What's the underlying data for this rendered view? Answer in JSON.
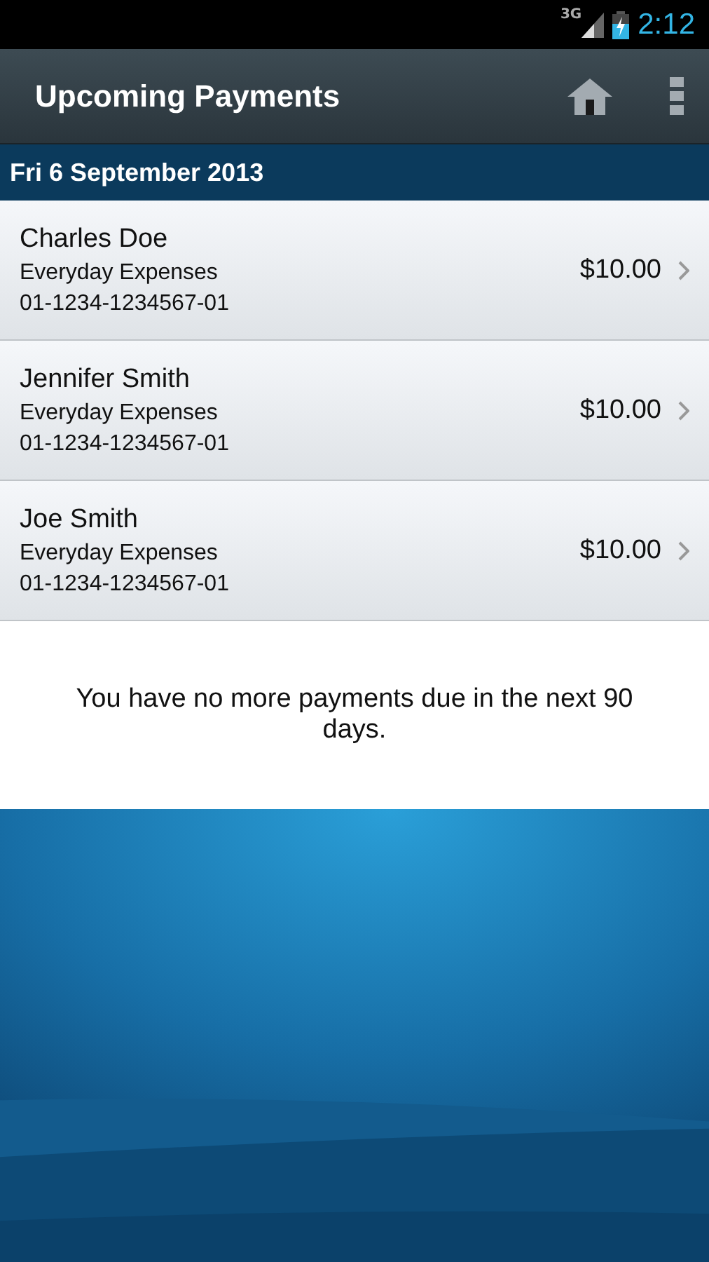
{
  "status_bar": {
    "network": "3G",
    "time": "2:12"
  },
  "action_bar": {
    "title": "Upcoming Payments"
  },
  "date_header": "Fri 6 September 2013",
  "payments": [
    {
      "name": "Charles Doe",
      "account_name": "Everyday Expenses",
      "account_number": "01-1234-1234567-01",
      "amount": "$10.00"
    },
    {
      "name": "Jennifer Smith",
      "account_name": "Everyday Expenses",
      "account_number": "01-1234-1234567-01",
      "amount": "$10.00"
    },
    {
      "name": "Joe Smith",
      "account_name": "Everyday Expenses",
      "account_number": "01-1234-1234567-01",
      "amount": "$10.00"
    }
  ],
  "message": "You have no more payments due in the next 90 days."
}
